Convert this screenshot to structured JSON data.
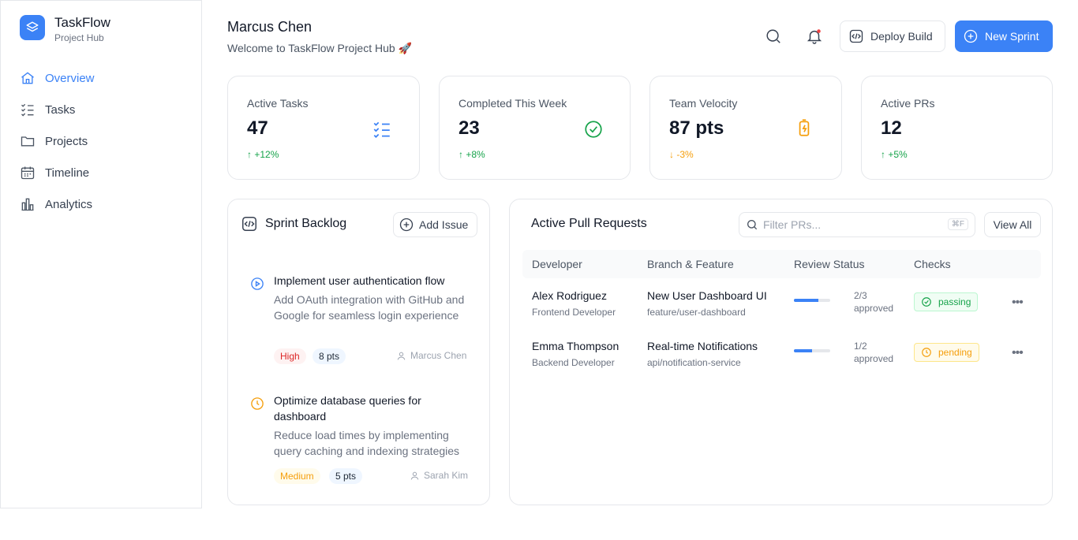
{
  "brand": {
    "title": "TaskFlow",
    "subtitle": "Project Hub"
  },
  "nav": [
    {
      "label": "Overview",
      "icon": "home-icon",
      "active": true
    },
    {
      "label": "Tasks",
      "icon": "list-check-icon"
    },
    {
      "label": "Projects",
      "icon": "folder-icon"
    },
    {
      "label": "Timeline",
      "icon": "calendar-icon"
    },
    {
      "label": "Analytics",
      "icon": "bar-chart-icon"
    }
  ],
  "header": {
    "name": "Marcus Chen",
    "welcome": "Welcome to TaskFlow Project Hub 🚀",
    "deploy_label": "Deploy Build",
    "new_sprint_label": "New Sprint"
  },
  "stats": [
    {
      "label": "Active Tasks",
      "value": "47",
      "change": "↑ +12%",
      "trend": "up",
      "icon": "list-check-icon"
    },
    {
      "label": "Completed This Week",
      "value": "23",
      "change": "↑ +8%",
      "trend": "up",
      "icon": "check-circle-icon"
    },
    {
      "label": "Team Velocity",
      "value": "87 pts",
      "change": "↓ -3%",
      "trend": "down",
      "icon": "battery-bolt-icon"
    },
    {
      "label": "Active PRs",
      "value": "12",
      "change": "↑ +5%",
      "trend": "up",
      "icon": ""
    }
  ],
  "backlog": {
    "title": "Sprint Backlog",
    "add_label": "Add Issue",
    "tasks": [
      {
        "title": "Implement user authentication flow",
        "description": "Add OAuth integration with GitHub and Google for seamless login experience",
        "priority": "High",
        "points": "8 pts",
        "assignee": "Marcus Chen",
        "icon": "play-circle-icon"
      },
      {
        "title": "Optimize database queries for dashboard",
        "description": "Reduce load times by implementing query caching and indexing strategies",
        "priority": "Medium",
        "points": "5 pts",
        "assignee": "Sarah Kim",
        "icon": "clock-icon"
      }
    ]
  },
  "prs": {
    "title": "Active Pull Requests",
    "search_placeholder": "Filter PRs...",
    "shortcut": "⌘F",
    "view_all_label": "View All",
    "columns": [
      "Developer",
      "Branch & Feature",
      "Review Status",
      "Checks"
    ],
    "rows": [
      {
        "name": "Alex Rodriguez",
        "role": "Frontend Developer",
        "feature": "New User Dashboard UI",
        "branch": "feature/user-dashboard",
        "review_count": "2/3",
        "review_word": "approved",
        "review_fraction": 0.67,
        "check": "passing",
        "check_status": "passing"
      },
      {
        "name": "Emma Thompson",
        "role": "Backend Developer",
        "feature": "Real-time Notifications",
        "branch": "api/notification-service",
        "review_count": "1/2",
        "review_word": "approved",
        "review_fraction": 0.5,
        "check": "pending",
        "check_status": "pending"
      }
    ]
  },
  "colors": {
    "accent": "#3b82f6",
    "success": "#16a34a",
    "warning": "#f59e0b",
    "danger": "#dc2626"
  }
}
